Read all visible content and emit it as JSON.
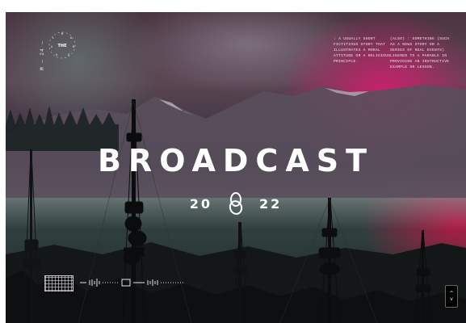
{
  "poster": {
    "vertical_label": "M — 24 —",
    "badge": {
      "letters": [
        "M",
        "A",
        "R",
        "S",
        "O",
        "U",
        "L"
      ],
      "center": "THE"
    },
    "blurb_left": ": A USUALLY SHORT FICTITIOUS STORY THAT ILLUSTRATES A MORAL ATTITUDE OR A RELIGIOUS PRINCIPLE.",
    "blurb_right": "(ALSO) : SOMETHING (SUCH AS A NEWS STORY OR A SERIES OF REAL EVENTS) LIKENED TO A PARABLE IN PROVIDING AN INSTRUCTIVE EXAMPLE OR LESSON.",
    "title": "BROADCAST",
    "year_left": "20",
    "year_right": "22"
  },
  "nav_button": {
    "arrow_up": "^",
    "arrow_down": "v"
  },
  "colors": {
    "red_glow": "#eb2814",
    "magenta_glow": "#d21e6e",
    "title_text": "#ffffff"
  }
}
